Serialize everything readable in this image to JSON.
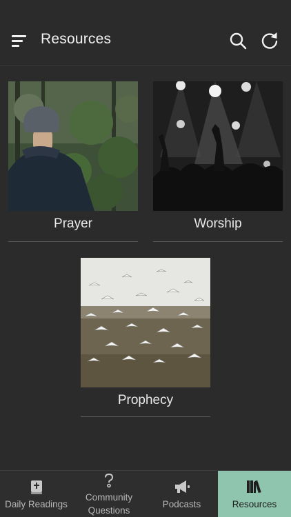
{
  "header": {
    "title": "Resources",
    "menu_icon": "hamburger-menu-icon",
    "search_icon": "search-icon",
    "refresh_icon": "refresh-icon"
  },
  "resources": [
    {
      "label": "Prayer",
      "image": "person-in-forest-photo"
    },
    {
      "label": "Worship",
      "image": "concert-crowd-photo"
    },
    {
      "label": "Prophecy",
      "image": "flock-of-seagulls-photo"
    }
  ],
  "tabs": [
    {
      "label": "Daily Readings",
      "icon": "bible-icon"
    },
    {
      "label_line1": "Community",
      "label_line2": "Questions",
      "icon": "question-mark-icon"
    },
    {
      "label": "Podcasts",
      "icon": "megaphone-icon"
    },
    {
      "label": "Resources",
      "icon": "books-icon",
      "active": true
    }
  ],
  "colors": {
    "background": "#2b2b2b",
    "active_tab": "#8fc4ae",
    "text": "#e6e6e6"
  }
}
